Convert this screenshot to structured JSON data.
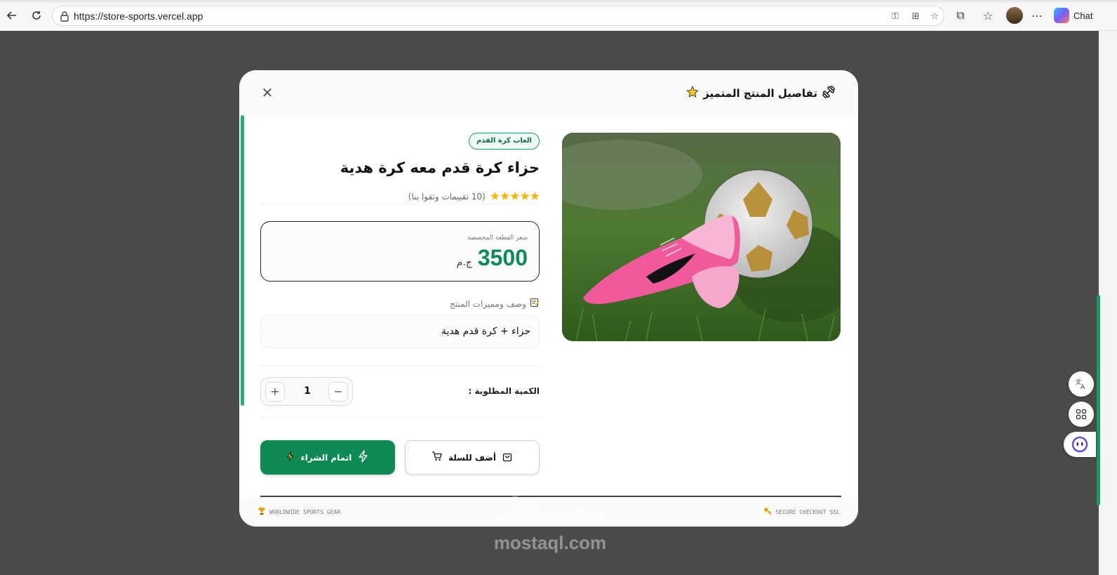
{
  "browser": {
    "url": "https://store-sports.vercel.app",
    "chat_label": "Chat"
  },
  "modal": {
    "title": "تفاصيل المنتج المتميز",
    "category_badge": "العاب كرة القدم",
    "product_title": "حزاء كرة قدم معه كرة هدية",
    "rating_stars": 5,
    "rating_text": "(10 تقييمات وثقوا بنا)",
    "price_label": "سعر القطعة المخصصة",
    "price": "3500",
    "currency": "ج.م",
    "description_label": "وصف ومميزات المنتج",
    "description": "حزاء + كرة قدم هدية",
    "quantity_label": "الكمية المطلوبة :",
    "quantity": "1",
    "buy_button": "اتمام الشراء",
    "cart_button": "أضف للسلة",
    "footer_left": "WORLDWIDE SPORTS GEAR",
    "footer_right": "SECURE CHECKOUT SSL"
  },
  "watermark": {
    "arabic": "مستقل",
    "latin": "mostaql.com"
  },
  "colors": {
    "accent": "#0e8a55",
    "star": "#f5b301"
  },
  "icons": [
    "back-icon",
    "reload-icon",
    "lock-icon",
    "key-icon",
    "grid-add-icon",
    "star-bookmark-icon",
    "extensions-icon",
    "favorites-icon",
    "more-icon",
    "close-icon",
    "dumbbell-icon",
    "star-icon",
    "memo-icon",
    "bolt-icon",
    "cart-icon",
    "bag-icon",
    "trophy-icon",
    "key-footer-icon",
    "translate-icon",
    "apps-icon",
    "assistant-icon"
  ]
}
